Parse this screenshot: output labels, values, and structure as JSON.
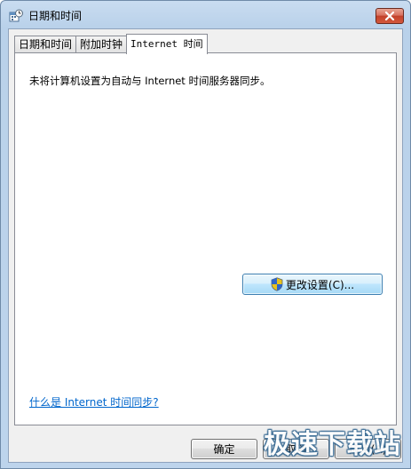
{
  "window": {
    "title": "日期和时间",
    "icon": "calendar-clock-icon",
    "close_icon": "close-icon"
  },
  "tabs": [
    {
      "label": "日期和时间",
      "active": false
    },
    {
      "label": "附加时钟",
      "active": false
    },
    {
      "label": "Internet 时间",
      "active": true
    }
  ],
  "panel": {
    "status_text": "未将计算机设置为自动与 Internet 时间服务器同步。",
    "change_settings_label": "更改设置(C)...",
    "change_settings_icon": "uac-shield-icon",
    "help_link": "什么是 Internet 时间同步?"
  },
  "buttons": {
    "ok": "确定",
    "cancel": "取消",
    "apply": "应用(A)"
  },
  "watermark": "极速下载站",
  "colors": {
    "link": "#0066cc",
    "close_button": "#c2412b",
    "highlight_button_border": "#3c7fb1"
  }
}
